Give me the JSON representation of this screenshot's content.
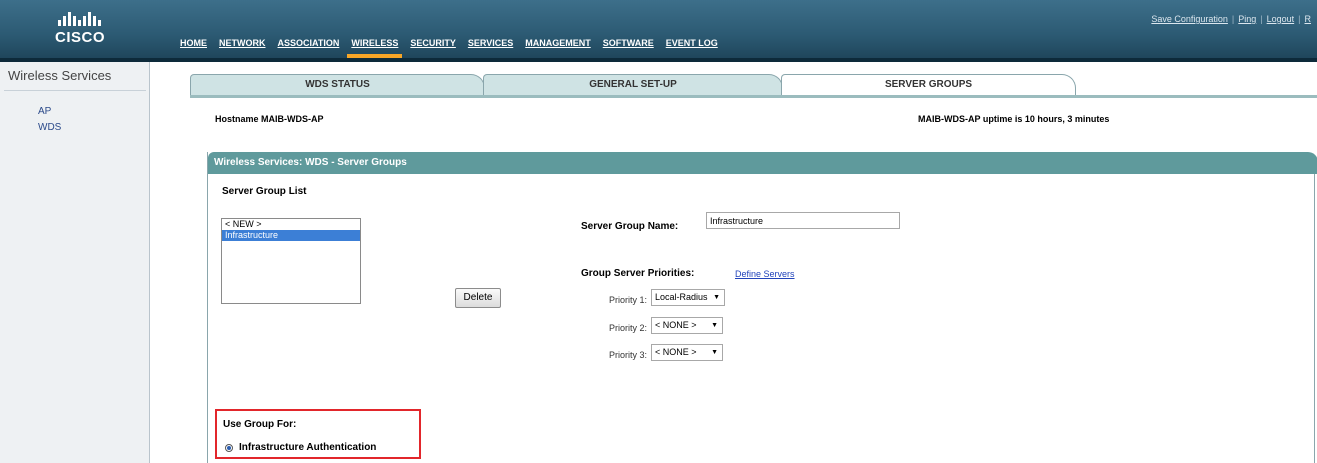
{
  "brand": {
    "logo_text": "CISCO"
  },
  "nav": {
    "items": [
      {
        "label": "HOME"
      },
      {
        "label": "NETWORK"
      },
      {
        "label": "ASSOCIATION"
      },
      {
        "label": "WIRELESS"
      },
      {
        "label": "SECURITY"
      },
      {
        "label": "SERVICES"
      },
      {
        "label": "MANAGEMENT"
      },
      {
        "label": "SOFTWARE"
      },
      {
        "label": "EVENT LOG"
      }
    ],
    "active": "WIRELESS",
    "active_color": "#f7a627"
  },
  "toplinks": {
    "save": "Save Configuration",
    "ping": "Ping",
    "logout": "Logout",
    "extra": "R"
  },
  "sidebar": {
    "title": "Wireless Services",
    "items": [
      {
        "label": "AP"
      },
      {
        "label": "WDS"
      }
    ]
  },
  "tabs": [
    {
      "label": "WDS STATUS"
    },
    {
      "label": "GENERAL SET-UP"
    },
    {
      "label": "SERVER GROUPS",
      "active": true
    }
  ],
  "hostname": "Hostname  MAIB-WDS-AP",
  "uptime": "MAIB-WDS-AP uptime is 10 hours, 3 minutes",
  "panel": {
    "title": "Wireless Services: WDS - Server Groups",
    "header_color": "#5f9a9c",
    "server_group_list_label": "Server Group List",
    "list_options": [
      {
        "label": "< NEW >"
      },
      {
        "label": "Infrastructure",
        "selected": true
      }
    ],
    "delete_label": "Delete",
    "server_group_name_label": "Server Group Name:",
    "server_group_name_value": "Infrastructure",
    "group_server_priorities_label": "Group Server Priorities:",
    "define_servers_link": "Define Servers",
    "priorities": [
      {
        "label": "Priority 1:",
        "value": "Local-Radius"
      },
      {
        "label": "Priority 2:",
        "value": "< NONE >"
      },
      {
        "label": "Priority 3:",
        "value": "< NONE >"
      }
    ],
    "use_group_for_label": "Use Group For:",
    "use_group_option": "Infrastructure Authentication",
    "highlight_color": "#e2262b"
  }
}
